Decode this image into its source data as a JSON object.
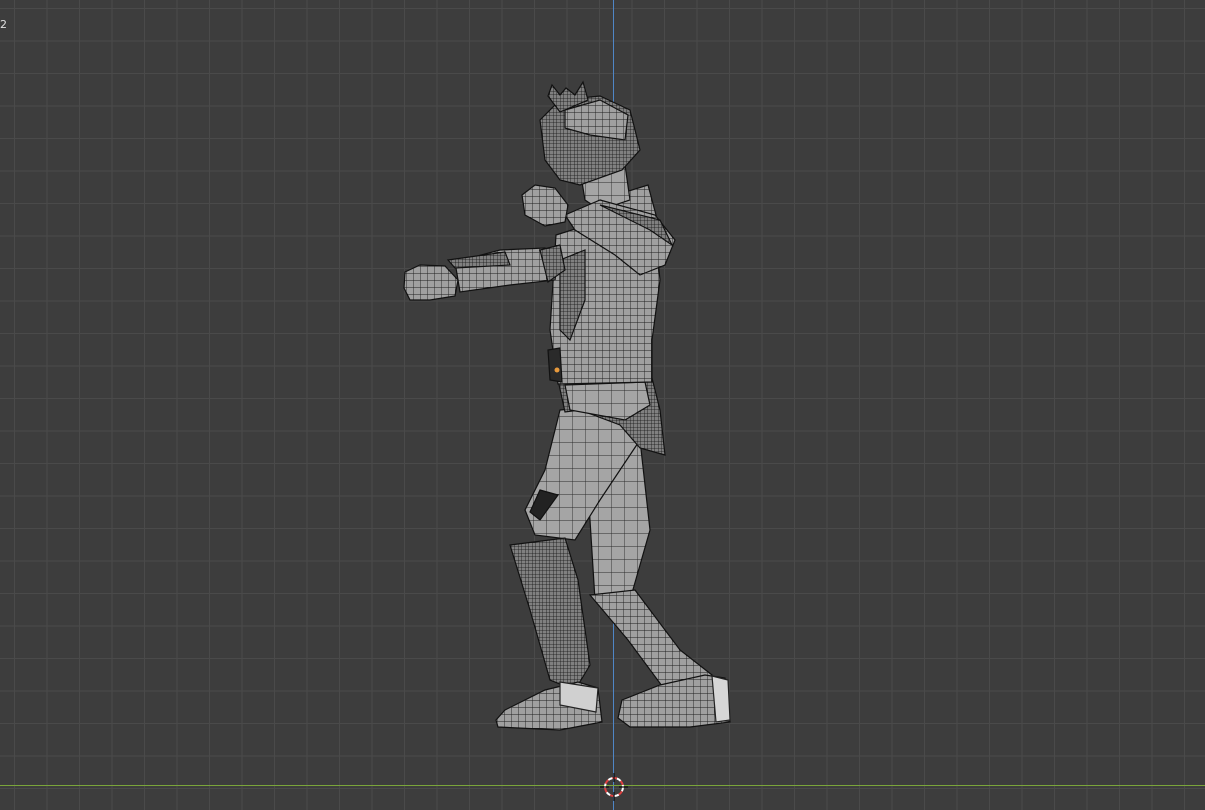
{
  "viewport": {
    "overlay_text": "2",
    "axis_colors": {
      "z": "#4f86c6",
      "y": "#7aa53a"
    },
    "background": "#3d3d3d",
    "grid_color": "#4a4a4a",
    "mesh_fill": "#9b9b9b",
    "wire_color": "#1a1a1a"
  },
  "icons": {
    "cursor": "3d-cursor-icon",
    "object": "mesh-object-wireframe",
    "origin": "object-origin-dot"
  }
}
